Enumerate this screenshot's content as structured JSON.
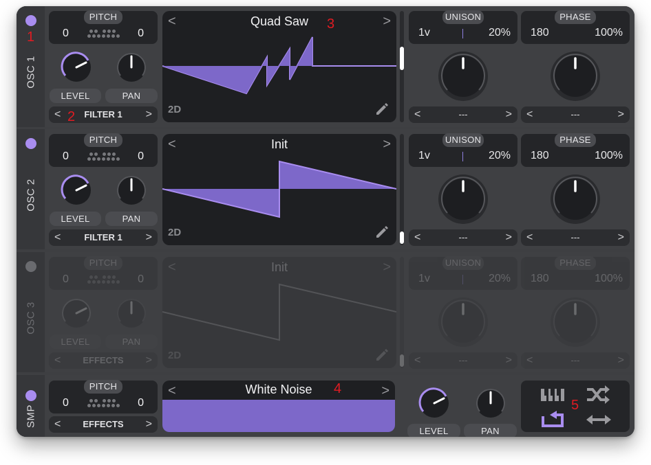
{
  "osc1": {
    "side_label": "OSC 1",
    "pitch_label": "PITCH",
    "transpose": "0",
    "tune": "0",
    "level_label": "LEVEL",
    "pan_label": "PAN",
    "destination": "FILTER 1",
    "wavetable_name": "Quad Saw",
    "view_mode": "2D",
    "unison_label": "UNISON",
    "unison_voices": "1v",
    "unison_detune": "20%",
    "phase_label": "PHASE",
    "phase_value": "180",
    "phase_random": "100%",
    "unison_mod": "---",
    "phase_mod": "---"
  },
  "osc2": {
    "side_label": "OSC 2",
    "pitch_label": "PITCH",
    "transpose": "0",
    "tune": "0",
    "level_label": "LEVEL",
    "pan_label": "PAN",
    "destination": "FILTER 1",
    "wavetable_name": "Init",
    "view_mode": "2D",
    "unison_label": "UNISON",
    "unison_voices": "1v",
    "unison_detune": "20%",
    "phase_label": "PHASE",
    "phase_value": "180",
    "phase_random": "100%",
    "unison_mod": "---",
    "phase_mod": "---"
  },
  "osc3": {
    "side_label": "OSC 3",
    "pitch_label": "PITCH",
    "transpose": "0",
    "tune": "0",
    "level_label": "LEVEL",
    "pan_label": "PAN",
    "destination": "EFFECTS",
    "wavetable_name": "Init",
    "view_mode": "2D",
    "unison_label": "UNISON",
    "unison_voices": "1v",
    "unison_detune": "20%",
    "phase_label": "PHASE",
    "phase_value": "180",
    "phase_random": "100%",
    "unison_mod": "---",
    "phase_mod": "---"
  },
  "smp": {
    "side_label": "SMP",
    "pitch_label": "PITCH",
    "transpose": "0",
    "tune": "0",
    "destination": "EFFECTS",
    "sample_name": "White Noise",
    "level_label": "LEVEL",
    "pan_label": "PAN"
  },
  "nav": {
    "prev": "<",
    "next": ">"
  },
  "annotations": [
    "1",
    "2",
    "3",
    "4",
    "5"
  ],
  "colors": {
    "accent": "#a98df0",
    "wave_fill": "#7d68c9",
    "panel": "#242528"
  },
  "icons": [
    "keyboard-icon",
    "shuffle-icon",
    "loop-icon",
    "bounce-icon",
    "pencil-icon"
  ]
}
